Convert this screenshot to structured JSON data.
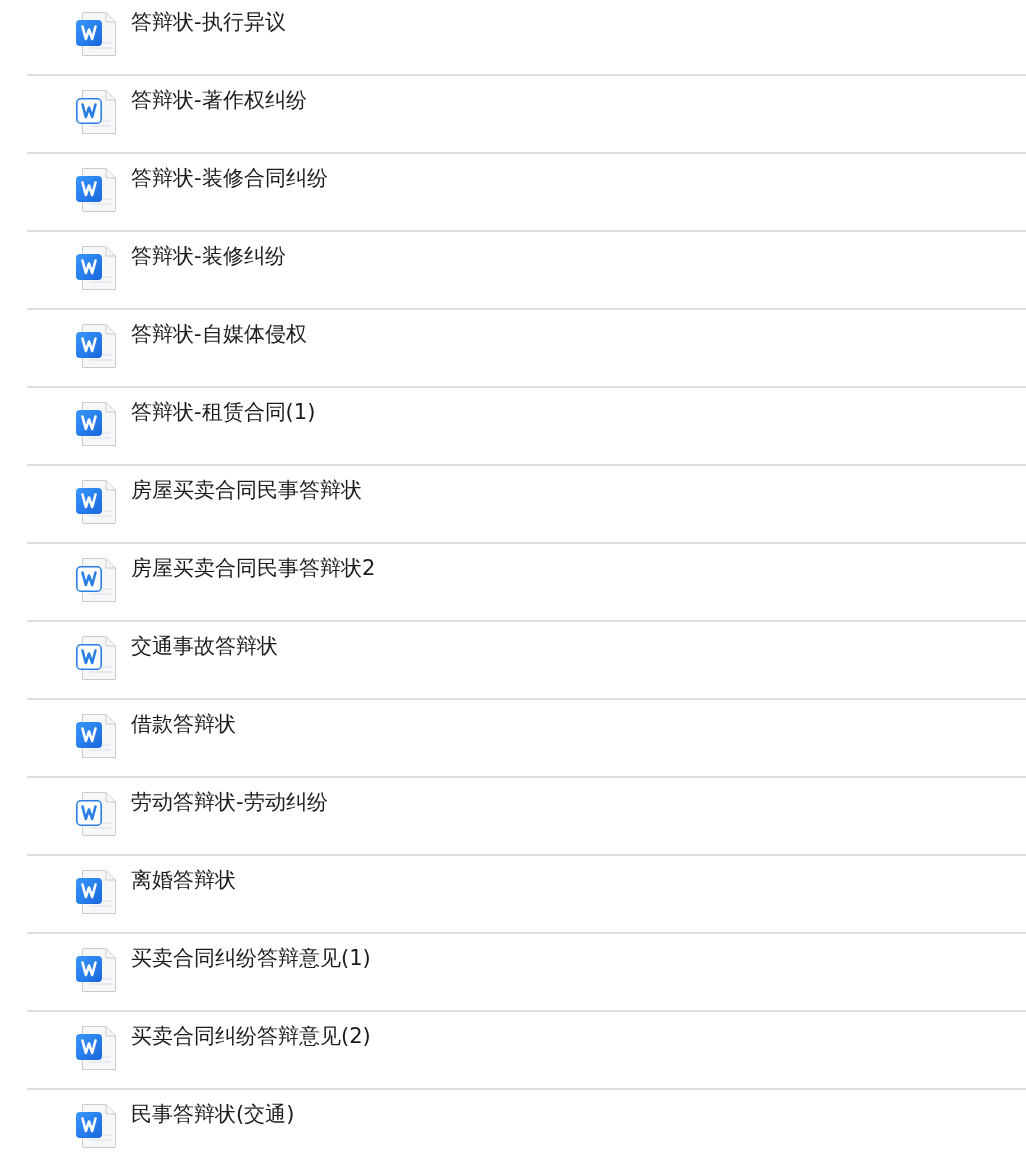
{
  "files": [
    {
      "name": "答辩状-执行异议",
      "kind": "filled"
    },
    {
      "name": "答辩状-著作权纠纷",
      "kind": "outline"
    },
    {
      "name": "答辩状-装修合同纠纷",
      "kind": "filled"
    },
    {
      "name": "答辩状-装修纠纷",
      "kind": "filled"
    },
    {
      "name": "答辩状-自媒体侵权",
      "kind": "filled"
    },
    {
      "name": "答辩状-租赁合同(1)",
      "kind": "filled"
    },
    {
      "name": "房屋买卖合同民事答辩状",
      "kind": "filled"
    },
    {
      "name": "房屋买卖合同民事答辩状2",
      "kind": "outline"
    },
    {
      "name": "交通事故答辩状",
      "kind": "outline"
    },
    {
      "name": "借款答辩状",
      "kind": "filled"
    },
    {
      "name": "劳动答辩状-劳动纠纷",
      "kind": "outline"
    },
    {
      "name": "离婚答辩状",
      "kind": "filled"
    },
    {
      "name": "买卖合同纠纷答辩意见(1)",
      "kind": "filled"
    },
    {
      "name": "买卖合同纠纷答辩意见(2)",
      "kind": "filled"
    },
    {
      "name": "民事答辩状(交通)",
      "kind": "filled"
    }
  ]
}
